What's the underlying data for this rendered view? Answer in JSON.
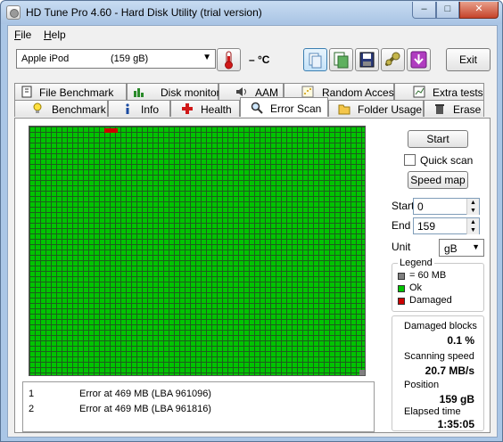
{
  "window": {
    "title": "HD Tune Pro 4.60 - Hard Disk Utility (trial version)",
    "min_glyph": "–",
    "max_glyph": "□",
    "close_glyph": "✕"
  },
  "menu": [
    {
      "key": "F",
      "rest": "ile"
    },
    {
      "key": "H",
      "rest": "elp"
    }
  ],
  "toolbar": {
    "drive_name": "Apple   iPod",
    "drive_size": "(159 gB)",
    "temperature": "– °C",
    "exit_label": "Exit"
  },
  "tabs_top": [
    "File Benchmark",
    "Disk monitor",
    "AAM",
    "Random Access",
    "Extra tests"
  ],
  "tabs_bottom": [
    "Benchmark",
    "Info",
    "Health",
    "Error Scan",
    "Folder Usage",
    "Erase"
  ],
  "active_tab": "Error Scan",
  "errors": [
    {
      "num": "1",
      "msg": "Error at 469 MB (LBA 961096)"
    },
    {
      "num": "2",
      "msg": "Error at 469 MB (LBA 961816)"
    }
  ],
  "controls": {
    "start_button": "Start",
    "quick_scan_label": "Quick scan",
    "quick_scan_checked": false,
    "speed_map_button": "Speed map",
    "start_label": "Start",
    "start_value": "0",
    "end_label": "End",
    "end_value": "159",
    "unit_label": "Unit",
    "unit_value": "gB"
  },
  "legend": {
    "title": "Legend",
    "items": [
      {
        "label": "= 60 MB",
        "color": "#808080"
      },
      {
        "label": "Ok",
        "color": "#00c400"
      },
      {
        "label": "Damaged",
        "color": "#cc0000"
      }
    ]
  },
  "stats": {
    "damaged_label": "Damaged blocks",
    "damaged_value": "0.1 %",
    "speed_label": "Scanning speed",
    "speed_value": "20.7 MB/s",
    "position_label": "Position",
    "position_value": "159 gB",
    "elapsed_label": "Elapsed time",
    "elapsed_value": "1:35:05"
  }
}
